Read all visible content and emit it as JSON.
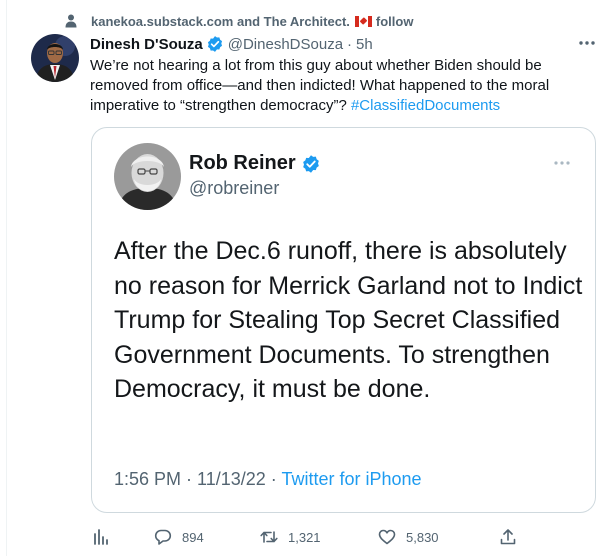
{
  "social_context": {
    "text": "kanekoa.substack.com and The Architect.",
    "follow_label": "follow"
  },
  "tweet": {
    "author_name": "Dinesh D'Souza",
    "handle": "@DineshDSouza",
    "separator": "·",
    "time": "5h",
    "text": "We’re not hearing a lot from this guy about whether Biden should be removed from office—and then indicted! What happened to the moral imperative to “strengthen democracy”? ",
    "hashtag": "#ClassifiedDocuments"
  },
  "quoted_screenshot": {
    "author_name": "Rob Reiner",
    "handle": "@robreiner",
    "text": "After the Dec.6 runoff, there is absolutely no reason for Merrick Garland not to Indict Trump for Stealing Top Secret Classified Government Documents. To strengthen Democracy, it must be done.",
    "timestamp": "1:56 PM · 11/13/22 · ",
    "source": "Twitter for iPhone"
  },
  "actions": {
    "replies": "894",
    "retweets": "1,321",
    "likes": "5,830"
  },
  "colors": {
    "link": "#1d9bf0",
    "muted": "#536471",
    "text": "#0f1419",
    "flag_red": "#d52b1e"
  }
}
